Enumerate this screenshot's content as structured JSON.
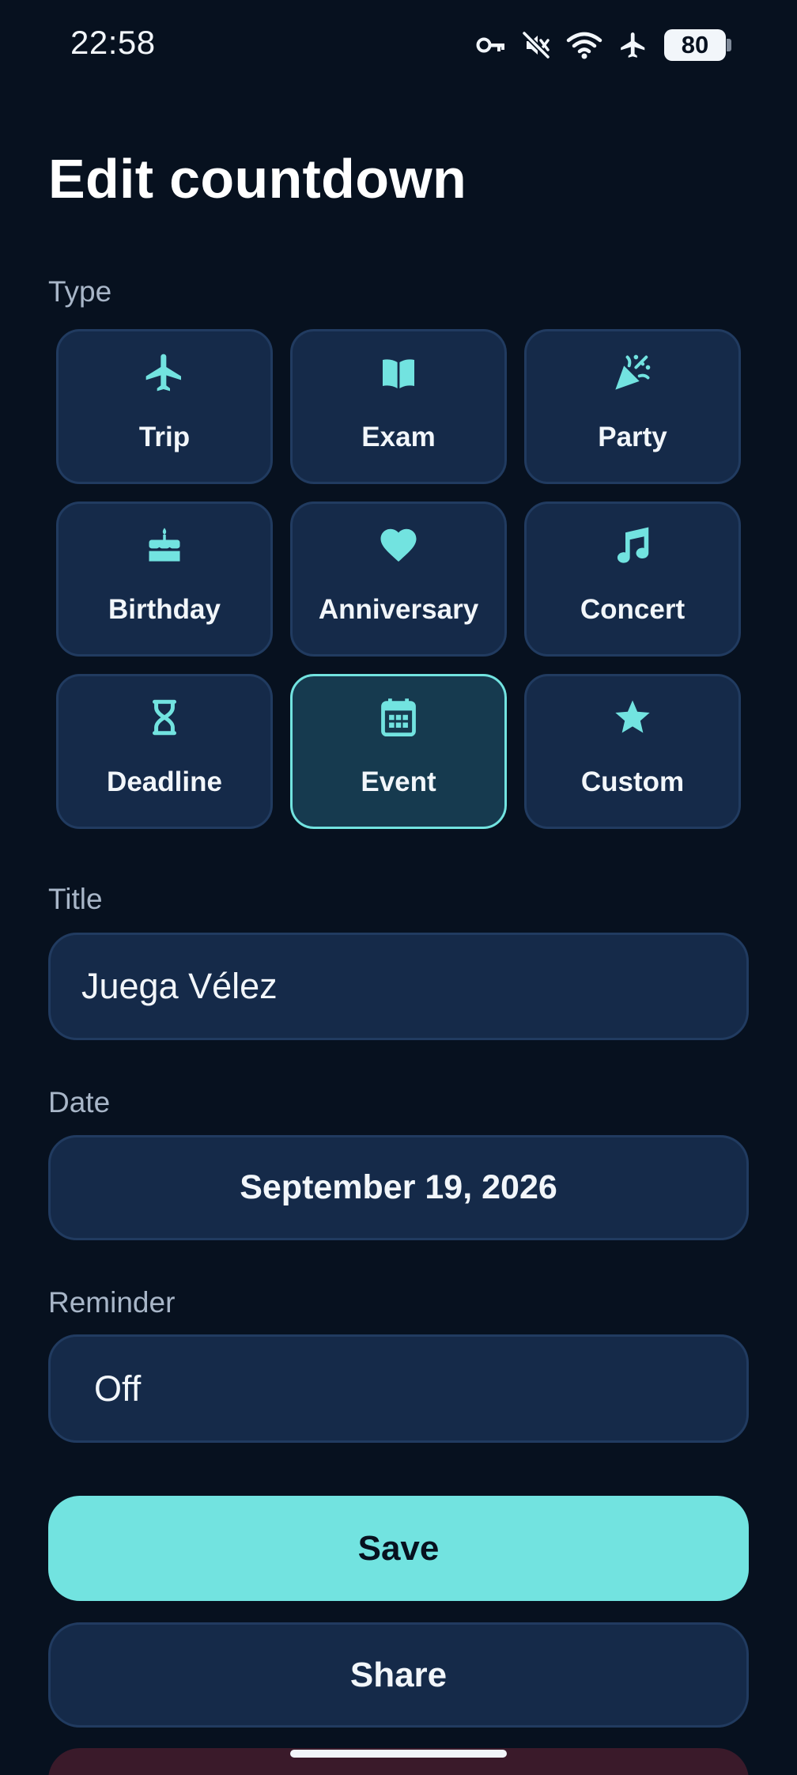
{
  "status_bar": {
    "time": "22:58",
    "battery": "80",
    "icons": [
      "vpn-key-icon",
      "mute-icon",
      "wifi-icon",
      "airplane-mode-icon",
      "battery-icon"
    ]
  },
  "page": {
    "title": "Edit countdown"
  },
  "type_section": {
    "label": "Type",
    "selected": "Event",
    "options": [
      {
        "label": "Trip",
        "icon": "airplane-icon"
      },
      {
        "label": "Exam",
        "icon": "book-icon"
      },
      {
        "label": "Party",
        "icon": "party-popper-icon"
      },
      {
        "label": "Birthday",
        "icon": "cake-icon"
      },
      {
        "label": "Anniversary",
        "icon": "heart-icon"
      },
      {
        "label": "Concert",
        "icon": "music-note-icon"
      },
      {
        "label": "Deadline",
        "icon": "hourglass-icon"
      },
      {
        "label": "Event",
        "icon": "calendar-icon"
      },
      {
        "label": "Custom",
        "icon": "star-icon"
      }
    ]
  },
  "title_field": {
    "label": "Title",
    "value": "Juega Vélez"
  },
  "date_field": {
    "label": "Date",
    "value": "September 19, 2026"
  },
  "reminder_field": {
    "label": "Reminder",
    "value": "Off"
  },
  "actions": {
    "save_label": "Save",
    "share_label": "Share"
  },
  "colors": {
    "background": "#07111f",
    "surface": "#152a49",
    "border": "#213b60",
    "accent": "#72e3e0",
    "selected_surface": "#163a4f",
    "delete_surface": "#3a1a2a"
  }
}
